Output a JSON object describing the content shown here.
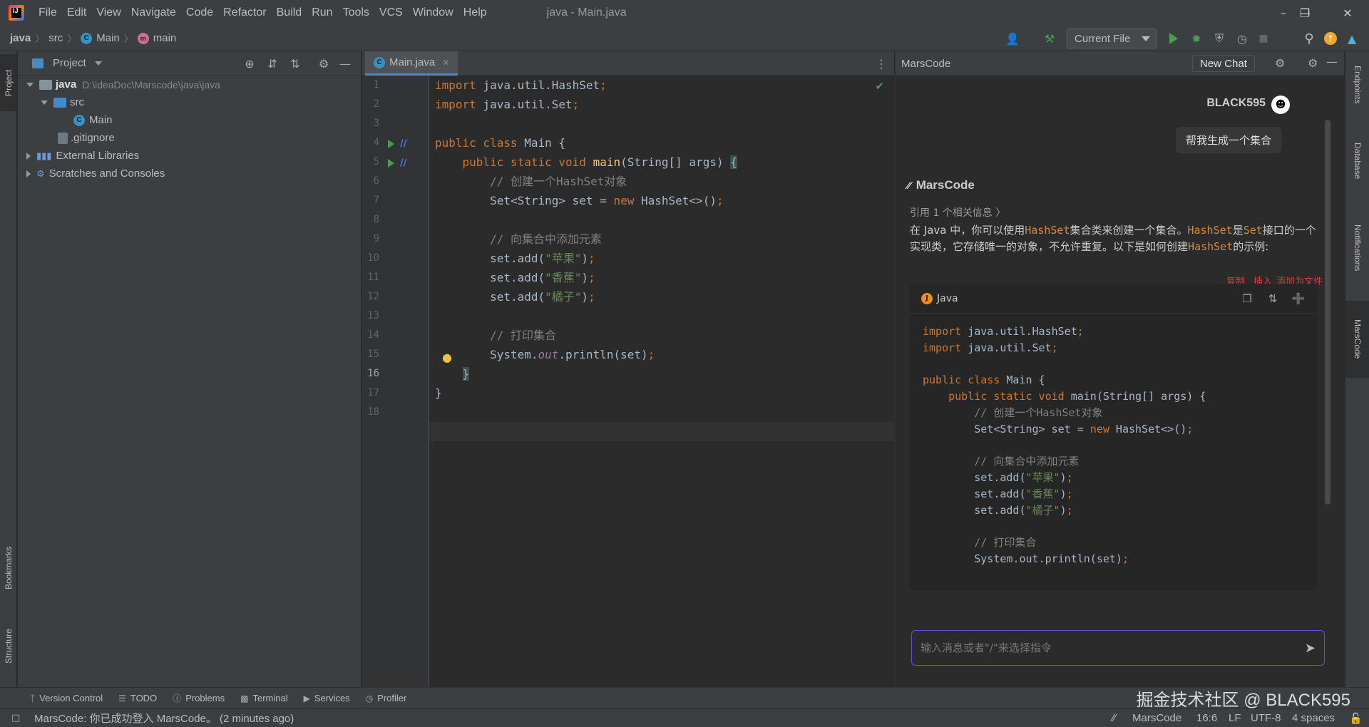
{
  "menubar": {
    "items": [
      "File",
      "Edit",
      "View",
      "Navigate",
      "Code",
      "Refactor",
      "Build",
      "Run",
      "Tools",
      "VCS",
      "Window",
      "Help"
    ],
    "window_title": "java - Main.java"
  },
  "navbar": {
    "crumbs": [
      "java",
      "src",
      "Main",
      "main"
    ],
    "run_config": "Current File"
  },
  "left_stripe": {
    "project": "Project",
    "bookmarks": "Bookmarks",
    "structure": "Structure"
  },
  "project_panel": {
    "title": "Project",
    "tree": {
      "root_name": "java",
      "root_path": "D:\\ideaDoc\\Marscode\\java\\java",
      "src": "src",
      "main": "Main",
      "gitignore": ".gitignore",
      "external": "External Libraries",
      "scratches": "Scratches and Consoles"
    }
  },
  "editor": {
    "tab": "Main.java",
    "current_line": 16,
    "line_numbers": [
      "1",
      "2",
      "3",
      "4",
      "5",
      "6",
      "7",
      "8",
      "9",
      "10",
      "11",
      "12",
      "13",
      "14",
      "15",
      "16",
      "17",
      "18"
    ]
  },
  "marscode": {
    "title": "MarsCode",
    "new_chat": "New Chat",
    "user_name": "BLACK595",
    "user_message": "帮我生成一个集合",
    "bot_name": "MarsCode",
    "ref_info": "引用 1 个相关信息 〉",
    "answer_parts": {
      "p1": "在 Java 中，你可以使用",
      "c1": "HashSet",
      "p2": "集合类来创建一个集合。",
      "c2": "HashSet",
      "p3": "是",
      "c3": "Set",
      "p4": "接口的一个实现类，它存储唯一的对象，不允许重复。以下是如何创建",
      "c4": "HashSet",
      "p5": "的示例:"
    },
    "red_actions": {
      "copy": "复制",
      "insert": "插入",
      "add_file": "添加为文件"
    },
    "code_lang": "Java",
    "input_placeholder": "输入消息或者\"/\"来选择指令"
  },
  "right_stripe": {
    "endpoints": "Endpoints",
    "database": "Database",
    "notifications": "Notifications",
    "marscode": "MarsCode"
  },
  "bottom_tools": [
    "Version Control",
    "TODO",
    "Problems",
    "Terminal",
    "Services",
    "Profiler"
  ],
  "watermark": "掘金技术社区 @ BLACK595",
  "statusbar": {
    "message": "MarsCode: 你已成功登入 MarsCode。 (2 minutes ago)",
    "plugin": "MarsCode",
    "position": "16:6",
    "line_sep": "LF",
    "encoding": "UTF-8",
    "indent": "4 spaces"
  },
  "colors": {
    "keyword": "#cc7832",
    "string": "#6a8759",
    "comment": "#808080",
    "function": "#ffc66d",
    "accent_run": "#499c54",
    "input_border": "#6a4bd1"
  }
}
